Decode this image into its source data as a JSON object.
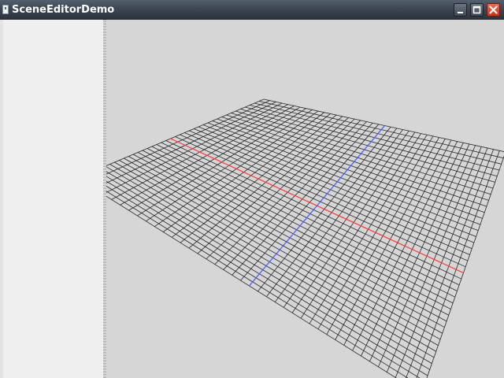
{
  "window": {
    "title": "SceneEditorDemo",
    "controls": {
      "minimize": "minimize-icon",
      "maximize": "maximize-icon",
      "close": "close-icon"
    }
  },
  "scene": {
    "grid_divisions": 40,
    "x_axis_color": "#ff3b3b",
    "z_axis_color": "#4a5cff",
    "grid_color": "#262626",
    "background_color": "#d6d6d6",
    "sidebar_color": "#efefef"
  }
}
